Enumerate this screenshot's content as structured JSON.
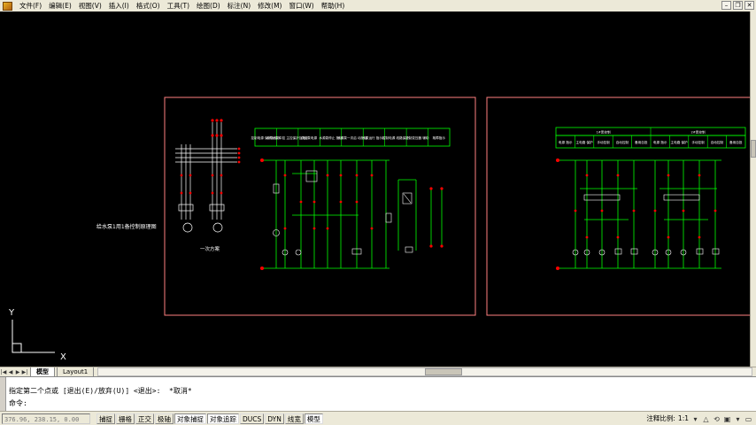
{
  "menu": [
    "文件(F)",
    "编辑(E)",
    "视图(V)",
    "插入(I)",
    "格式(O)",
    "工具(T)",
    "绘图(D)",
    "标注(N)",
    "修改(M)",
    "窗口(W)",
    "帮助(H)"
  ],
  "window_buttons": {
    "minimize": "–",
    "restore": "❐",
    "close": "✕"
  },
  "drawing": {
    "side_title": "给水泵1用1备控制原理图",
    "primary_label": "一次方案",
    "left_headers": [
      "控制电源 保护及指示",
      "水源水泵中控 主控保护及指示",
      "供应泵电源",
      "水源泵停止 按钮",
      "水源泵一次启 动按钮",
      "水泵运行 指示灯",
      "控制电源 线路保护",
      "控制变压器 辅助",
      "故障指示"
    ],
    "right_headers_top": [
      "1#泵控制",
      "2#泵控制"
    ],
    "right_headers": [
      "电源 指示",
      "主电路 保护",
      "手动控制",
      "自动控制",
      "备用自投",
      "电源 指示",
      "主电路 保护",
      "手动控制",
      "自动控制",
      "备用自投"
    ],
    "ucs": {
      "x": "X",
      "y": "Y"
    }
  },
  "tabs": {
    "model": "模型",
    "layout1": "Layout1"
  },
  "command": {
    "history": "指定第二个点或 [退出(E)/放弃(U)] <退出>:  *取消*",
    "prompt": "命令:"
  },
  "status": {
    "coords": "376.96, 238.15, 0.00",
    "toggles": [
      {
        "label": "捕捉",
        "on": false
      },
      {
        "label": "栅格",
        "on": false
      },
      {
        "label": "正交",
        "on": false
      },
      {
        "label": "极轴",
        "on": false
      },
      {
        "label": "对象捕捉",
        "on": true
      },
      {
        "label": "对象追踪",
        "on": true
      },
      {
        "label": "DUCS",
        "on": false
      },
      {
        "label": "DYN",
        "on": false
      },
      {
        "label": "线宽",
        "on": false
      },
      {
        "label": "模型",
        "on": true
      }
    ],
    "annotation_scale_label": "注释比例:",
    "annotation_scale": "1:1"
  },
  "colors": {
    "canvas": "#000000",
    "frame": "#ff8080",
    "wire": "#00ff00",
    "accent": "#ff3030",
    "text": "#ffffff",
    "terminal": "#ff0000",
    "symbol": "#ffff00"
  }
}
